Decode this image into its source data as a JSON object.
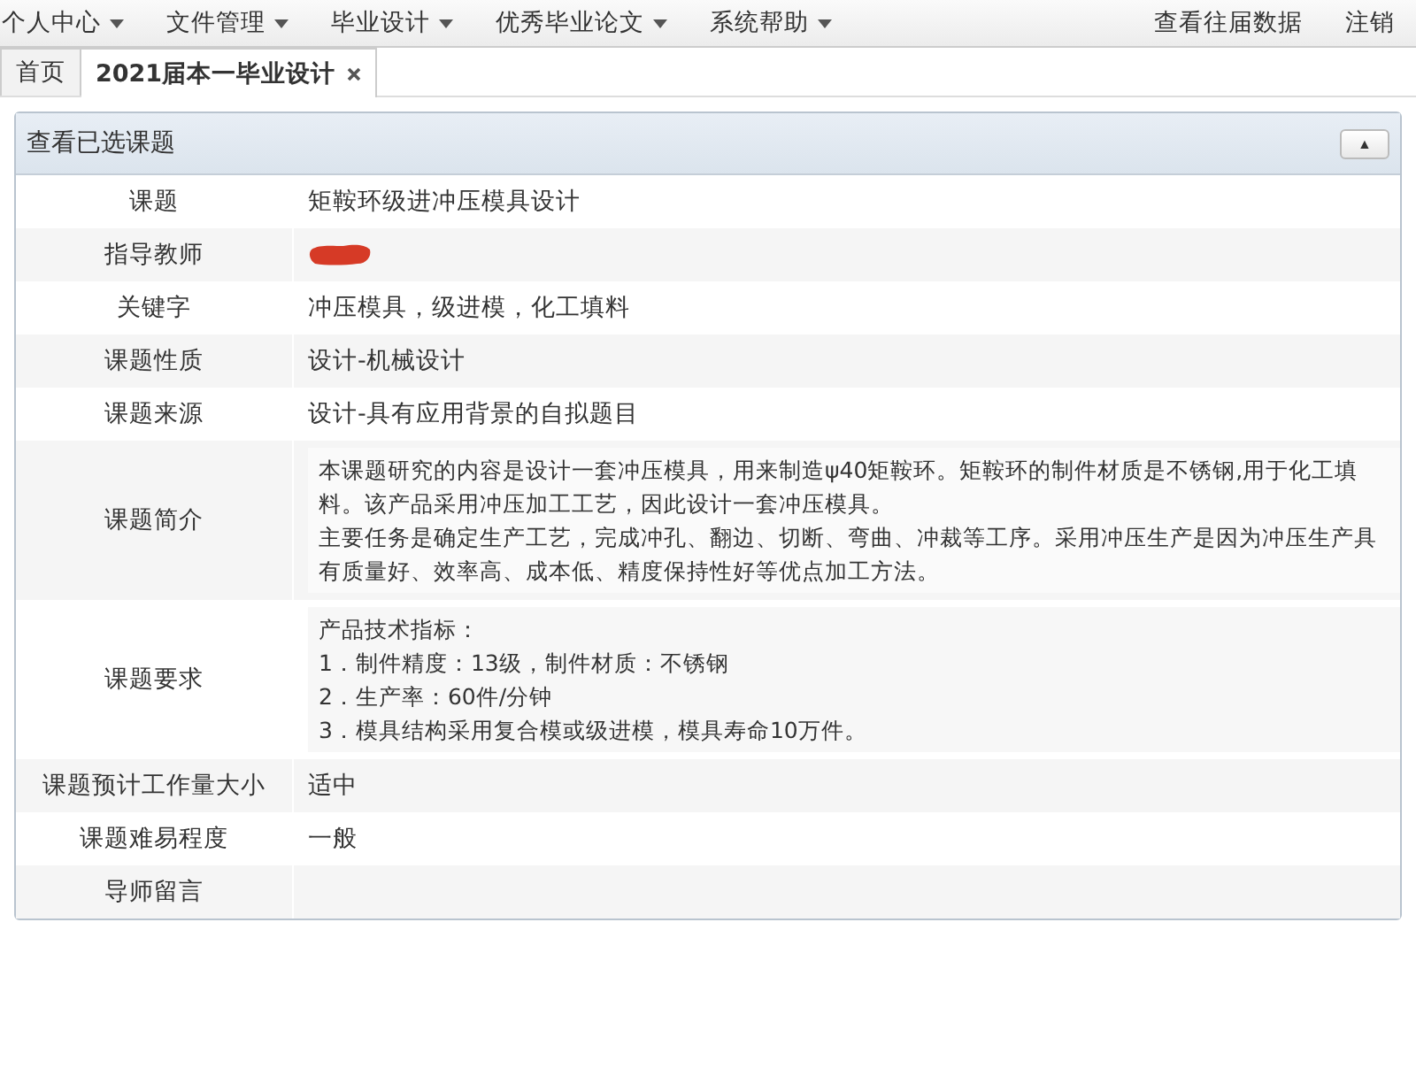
{
  "menu": [
    {
      "label": "个人中心",
      "dropdown": true
    },
    {
      "label": "文件管理",
      "dropdown": true
    },
    {
      "label": "毕业设计",
      "dropdown": true
    },
    {
      "label": "优秀毕业论文",
      "dropdown": true
    },
    {
      "label": "系统帮助",
      "dropdown": true
    }
  ],
  "menu_right": [
    {
      "label": "查看往届数据"
    },
    {
      "label": "注销"
    }
  ],
  "tabs": [
    {
      "label": "首页",
      "selected": false,
      "closable": false
    },
    {
      "label": "2021届本一毕业设计",
      "selected": true,
      "closable": true
    }
  ],
  "panel": {
    "title": "查看已选课题",
    "collapse_button": "▲",
    "rows": [
      {
        "label": "课题",
        "kind": "text",
        "value": "矩鞍环级进冲压模具设计"
      },
      {
        "label": "指导教师",
        "kind": "redacted"
      },
      {
        "label": "关键字",
        "kind": "text",
        "value": "冲压模具，级进模，化工填料"
      },
      {
        "label": "课题性质",
        "kind": "text",
        "value": "设计-机械设计"
      },
      {
        "label": "课题来源",
        "kind": "text",
        "value": "设计-具有应用背景的自拟题目"
      },
      {
        "label": "课题简介",
        "kind": "block",
        "lines": [
          "本课题研究的内容是设计一套冲压模具，用来制造ψ40矩鞍环。矩鞍环的制件材质是不锈钢,用于化工填料。该产品采用冲压加工工艺，因此设计一套冲压模具。",
          "主要任务是确定生产工艺，完成冲孔、翻边、切断、弯曲、冲裁等工序。采用冲压生产是因为冲压生产具有质量好、效率高、成本低、精度保持性好等优点加工方法。"
        ]
      },
      {
        "label": "课题要求",
        "kind": "block",
        "lines": [
          "产品技术指标：",
          "1．制件精度：13级，制件材质：不锈钢",
          "2．生产率：60件/分钟",
          "3．模具结构采用复合模或级进模，模具寿命10万件。"
        ]
      },
      {
        "label": "课题预计工作量大小",
        "kind": "text",
        "value": "适中"
      },
      {
        "label": "课题难易程度",
        "kind": "text",
        "value": "一般"
      },
      {
        "label": "导师留言",
        "kind": "empty"
      }
    ]
  }
}
